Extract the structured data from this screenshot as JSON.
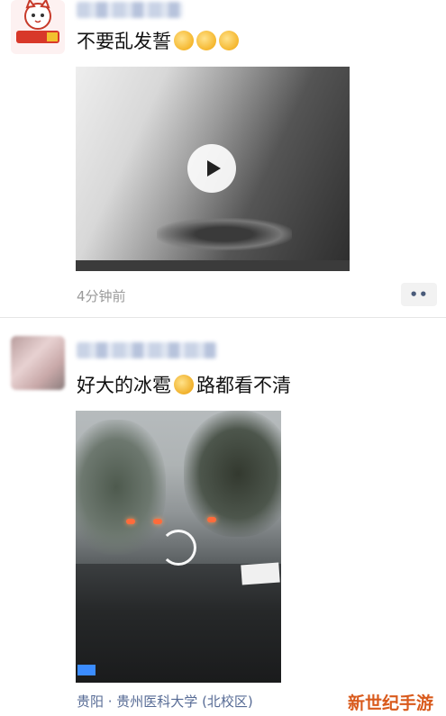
{
  "post1": {
    "avatar_icon": "cat-sticker-avatar",
    "text": "不要乱发誓",
    "emoji_count": 3,
    "media_type": "video",
    "play_icon": "play-icon",
    "time": "4分钟前",
    "more_label": "••"
  },
  "post2": {
    "avatar_icon": "blurred-avatar",
    "text_before_emoji": "好大的冰雹",
    "text_after_emoji": "路都看不清",
    "media_type": "video",
    "loading_icon": "loading-spinner-icon",
    "location": "贵阳 · 贵州医科大学 (北校区)"
  },
  "watermark": "新世纪手游",
  "colors": {
    "link": "#576b95",
    "time": "#9a9a9a",
    "watermark": "#d95a1c"
  }
}
